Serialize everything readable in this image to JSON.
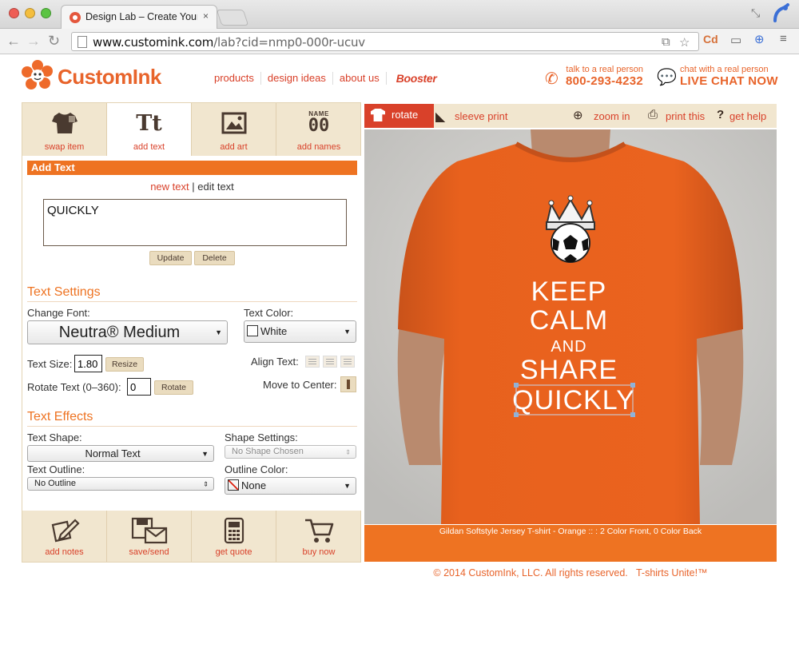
{
  "browser": {
    "tab_title": "Design Lab – Create Your C",
    "tab_close": "×",
    "url_host": "www.customink.com",
    "url_path": "/lab?cid=nmp0-000r-ucuv",
    "ext_cd": "Cd"
  },
  "site": {
    "logo_text": "CustomInk",
    "nav": [
      "products",
      "design ideas",
      "about us"
    ],
    "booster": "Booster",
    "phone_label": "talk to a real person",
    "phone_number": "800-293-4232",
    "chat_label": "chat with a real person",
    "chat_cta": "LIVE CHAT NOW"
  },
  "tools": {
    "tabs": [
      {
        "label": "swap item",
        "icon": "tshirt-icon"
      },
      {
        "label": "add text",
        "icon": "text-icon",
        "glyph": "Tt"
      },
      {
        "label": "add art",
        "icon": "picture-icon"
      },
      {
        "label": "add names",
        "icon": "names-numbers-icon",
        "glyph_top": "NAME",
        "glyph_num": "00"
      }
    ]
  },
  "add_text": {
    "header": "Add Text",
    "new_text": "new text",
    "separator": "|",
    "edit_text": "edit text",
    "text_value": "QUICKLY",
    "update_label": "Update",
    "delete_label": "Delete"
  },
  "text_settings": {
    "title": "Text Settings",
    "change_font_label": "Change Font:",
    "font_value": "Neutra® Medium",
    "text_color_label": "Text Color:",
    "text_color_value": "White",
    "text_size_label": "Text Size:",
    "text_size_value": "1.80",
    "resize_label": "Resize",
    "align_label": "Align Text:",
    "rotate_label": "Rotate Text (0–360):",
    "rotate_value": "0",
    "rotate_btn": "Rotate",
    "move_center_label": "Move to Center:"
  },
  "text_effects": {
    "title": "Text Effects",
    "shape_label": "Text Shape:",
    "shape_value": "Normal Text",
    "shape_settings_label": "Shape Settings:",
    "shape_settings_value": "No Shape Chosen",
    "outline_label": "Text Outline:",
    "outline_value": "No Outline",
    "outline_color_label": "Outline Color:",
    "outline_color_value": "None"
  },
  "bottom_actions": [
    {
      "label": "add notes",
      "icon": "notepad-pencil-icon"
    },
    {
      "label": "save/send",
      "icon": "save-envelope-icon"
    },
    {
      "label": "get quote",
      "icon": "calculator-icon"
    },
    {
      "label": "buy now",
      "icon": "shopping-cart-icon"
    }
  ],
  "preview": {
    "rotate_label": "rotate",
    "sleeve_label": "sleeve print",
    "zoom_label": "zoom in",
    "print_label": "print this",
    "help_label": "get help",
    "design_lines": [
      "KEEP",
      "CALM",
      "AND",
      "SHARE",
      "QUICKLY"
    ],
    "caption": "Gildan Softstyle Jersey T-shirt - Orange :: : 2 Color Front, 0 Color Back",
    "shirt_color": "#e8611d"
  },
  "footer": {
    "copyright": "© 2014 CustomInk, LLC. All rights reserved.",
    "tagline": "T-shirts Unite!™"
  },
  "colors": {
    "brand_orange": "#ee7322",
    "link_red": "#d9412a",
    "panel_tan": "#f1e6cf"
  }
}
